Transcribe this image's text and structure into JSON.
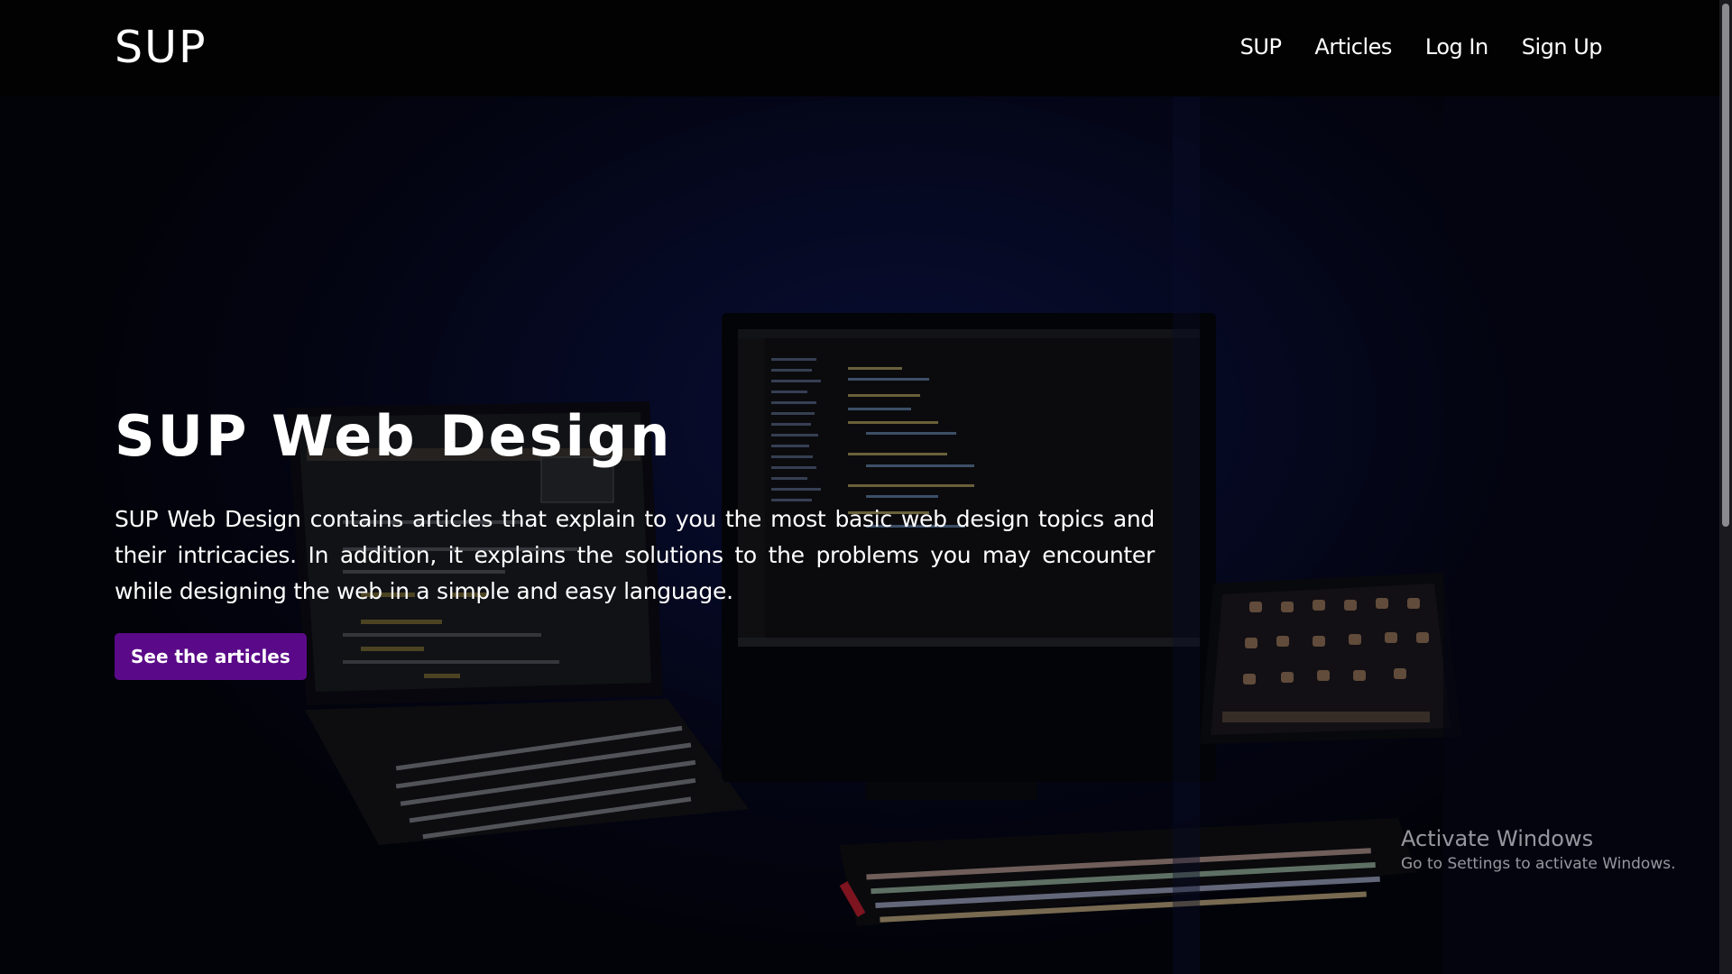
{
  "navbar": {
    "brand": "SUP",
    "links": [
      "SUP",
      "Articles",
      "Log In",
      "Sign Up"
    ]
  },
  "hero": {
    "title": "SUP Web Design",
    "description": "SUP Web Design contains articles that explain to you the most basic web design topics and their intricacies. In addition, it explains the solutions to the problems you may encounter while designing the web in a simple and easy language.",
    "cta_label": "See the articles",
    "background_image": "dark desk with laptop, monitor with code editor, tablet and RGB keyboard"
  },
  "watermark": {
    "title": "Activate Windows",
    "subtitle": "Go to Settings to activate Windows."
  },
  "colors": {
    "navbar_bg": "#020203",
    "cta_bg": "#5a0a88",
    "text": "#ffffff"
  }
}
